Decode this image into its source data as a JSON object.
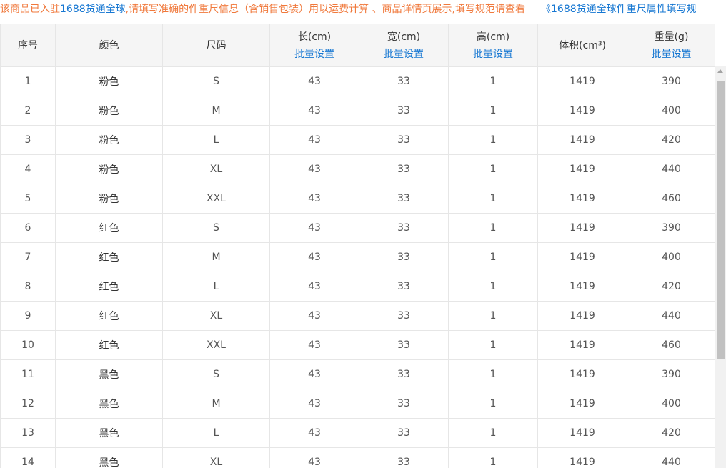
{
  "notice": {
    "part1": "该商品已入驻",
    "part2_blue": "1688货通全球",
    "part3": ",请填写准确的件重尺信息（含销售包装）用以运费计算 、商品详情页展示,填写规范请查看",
    "link": "《1688货通全球件重尺属性填写规"
  },
  "table": {
    "headers": {
      "index": "序号",
      "color": "颜色",
      "size": "尺码",
      "length": "长(cm)",
      "width": "宽(cm)",
      "height": "高(cm)",
      "volume": "体积(cm³)",
      "weight": "重量(g)",
      "batch_label": "批量设置"
    },
    "rows": [
      {
        "index": "1",
        "color": "粉色",
        "size": "S",
        "length": "43",
        "width": "33",
        "height": "1",
        "volume": "1419",
        "weight": "390"
      },
      {
        "index": "2",
        "color": "粉色",
        "size": "M",
        "length": "43",
        "width": "33",
        "height": "1",
        "volume": "1419",
        "weight": "400"
      },
      {
        "index": "3",
        "color": "粉色",
        "size": "L",
        "length": "43",
        "width": "33",
        "height": "1",
        "volume": "1419",
        "weight": "420"
      },
      {
        "index": "4",
        "color": "粉色",
        "size": "XL",
        "length": "43",
        "width": "33",
        "height": "1",
        "volume": "1419",
        "weight": "440"
      },
      {
        "index": "5",
        "color": "粉色",
        "size": "XXL",
        "length": "43",
        "width": "33",
        "height": "1",
        "volume": "1419",
        "weight": "460"
      },
      {
        "index": "6",
        "color": "红色",
        "size": "S",
        "length": "43",
        "width": "33",
        "height": "1",
        "volume": "1419",
        "weight": "390"
      },
      {
        "index": "7",
        "color": "红色",
        "size": "M",
        "length": "43",
        "width": "33",
        "height": "1",
        "volume": "1419",
        "weight": "400"
      },
      {
        "index": "8",
        "color": "红色",
        "size": "L",
        "length": "43",
        "width": "33",
        "height": "1",
        "volume": "1419",
        "weight": "420"
      },
      {
        "index": "9",
        "color": "红色",
        "size": "XL",
        "length": "43",
        "width": "33",
        "height": "1",
        "volume": "1419",
        "weight": "440"
      },
      {
        "index": "10",
        "color": "红色",
        "size": "XXL",
        "length": "43",
        "width": "33",
        "height": "1",
        "volume": "1419",
        "weight": "460"
      },
      {
        "index": "11",
        "color": "黑色",
        "size": "S",
        "length": "43",
        "width": "33",
        "height": "1",
        "volume": "1419",
        "weight": "390"
      },
      {
        "index": "12",
        "color": "黑色",
        "size": "M",
        "length": "43",
        "width": "33",
        "height": "1",
        "volume": "1419",
        "weight": "400"
      },
      {
        "index": "13",
        "color": "黑色",
        "size": "L",
        "length": "43",
        "width": "33",
        "height": "1",
        "volume": "1419",
        "weight": "420"
      },
      {
        "index": "14",
        "color": "黑色",
        "size": "XL",
        "length": "43",
        "width": "33",
        "height": "1",
        "volume": "1419",
        "weight": "440"
      }
    ]
  },
  "colors": {
    "notice_orange": "#f0793c",
    "accent_blue": "#1677d2",
    "header_bg": "#f5f5f5",
    "border": "#e6e6e6"
  }
}
